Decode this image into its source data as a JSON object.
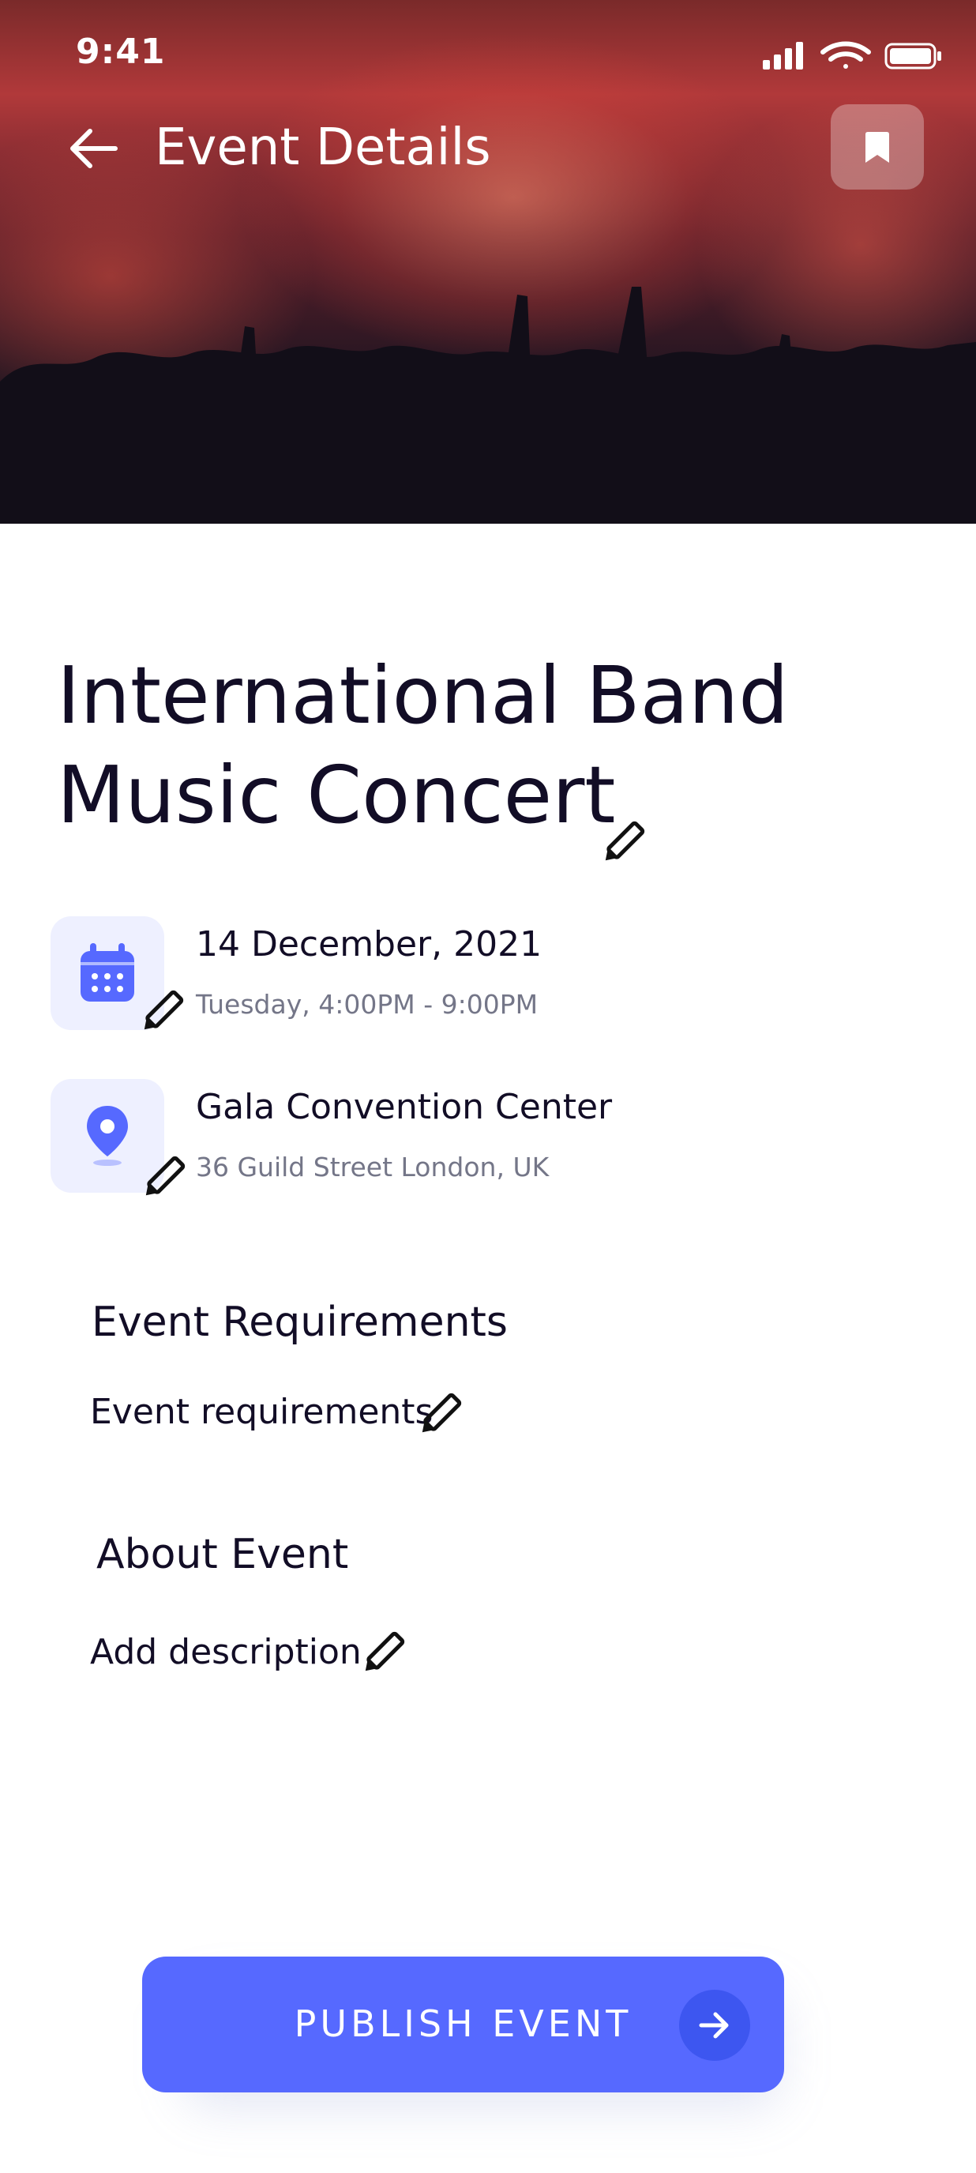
{
  "status_bar": {
    "time": "9:41"
  },
  "header": {
    "title": "Event Details"
  },
  "event": {
    "title_line1": "International Band",
    "title_line2": "Music Concert",
    "date_main": "14 December, 2021",
    "date_sub": "Tuesday, 4:00PM - 9:00PM",
    "venue_main": "Gala Convention Center",
    "venue_sub": "36 Guild Street London, UK"
  },
  "requirements": {
    "heading": "Event Requirements",
    "value": "Event requirements"
  },
  "about": {
    "heading": "About Event",
    "value": "Add description"
  },
  "cta": {
    "label": "PUBLISH EVENT"
  },
  "colors": {
    "accent": "#5669ff",
    "icon_bg": "#eef0ff",
    "text": "#120d26",
    "muted": "#747688"
  }
}
